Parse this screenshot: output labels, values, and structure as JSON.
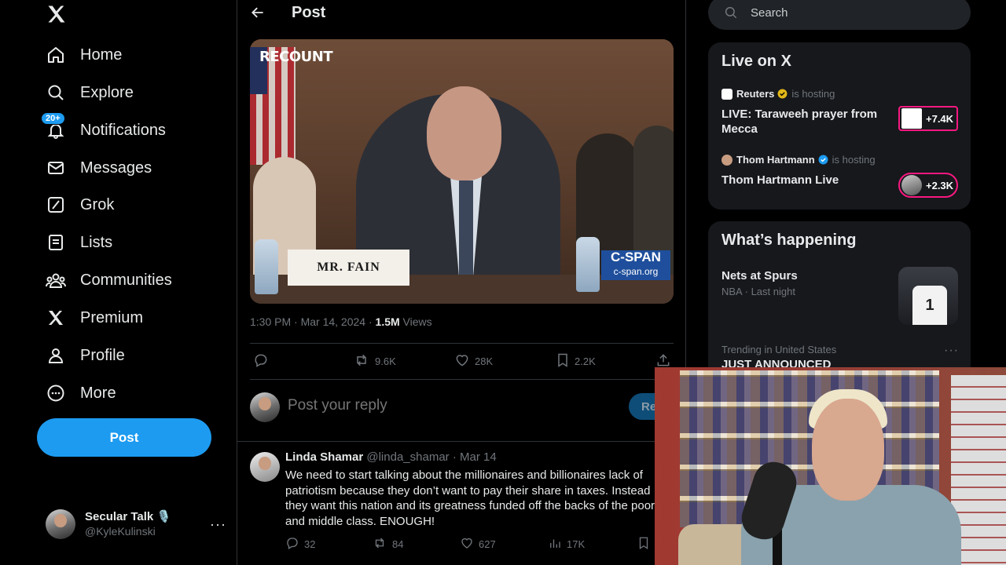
{
  "nav": {
    "items": [
      {
        "label": "Home",
        "icon": "home-icon"
      },
      {
        "label": "Explore",
        "icon": "search-icon"
      },
      {
        "label": "Notifications",
        "icon": "bell-icon",
        "badge": "20+"
      },
      {
        "label": "Messages",
        "icon": "mail-icon"
      },
      {
        "label": "Grok",
        "icon": "grok-icon"
      },
      {
        "label": "Lists",
        "icon": "lists-icon"
      },
      {
        "label": "Communities",
        "icon": "communities-icon"
      },
      {
        "label": "Premium",
        "icon": "x-logo-icon"
      },
      {
        "label": "Profile",
        "icon": "profile-icon"
      },
      {
        "label": "More",
        "icon": "more-circle-icon"
      }
    ],
    "post_button": "Post",
    "account": {
      "name": "Secular Talk 🎙️",
      "handle": "@KyleKulinski",
      "more": "···"
    }
  },
  "post": {
    "header_title": "Post",
    "media": {
      "watermark": "RECOUNT",
      "nameplate": "MR. FAIN",
      "network": "C-SPAN",
      "network_url": "c-span.org"
    },
    "time": "1:30 PM · Mar 14, 2024 · ",
    "views_count": "1.5M",
    "views_label": " Views",
    "stats": {
      "reposts": "9.6K",
      "likes": "28K",
      "bookmarks": "2.2K"
    },
    "reply_placeholder": "Post your reply",
    "reply_button": "Reply"
  },
  "comment": {
    "name": "Linda Shamar",
    "handle": "@linda_shamar",
    "date": " · Mar 14",
    "text": "We need to start talking about the millionaires and billionaires lack of patriotism because they don’t want to pay their share in taxes. Instead they want this nation and its greatness funded off the backs of the poor and middle class. ENOUGH!",
    "stats": {
      "replies": "32",
      "reposts": "84",
      "likes": "627",
      "views": "17K"
    }
  },
  "search": {
    "placeholder": "Search"
  },
  "live": {
    "title": "Live on X",
    "hosting_label": "is hosting",
    "items": [
      {
        "host": "Reuters",
        "title": "LIVE: Taraweeh prayer from Mecca",
        "count": "+7.4K"
      },
      {
        "host": "Thom Hartmann",
        "title": "Thom Hartmann Live",
        "count": "+2.3K"
      }
    ]
  },
  "happening": {
    "title": "What’s happening",
    "trends": [
      {
        "title": "Nets at Spurs",
        "sub": "NBA · Last night",
        "jersey": "1"
      },
      {
        "context": "Trending in United States",
        "title": "JUST ANNOUNCED"
      }
    ]
  },
  "colors": {
    "accent": "#1d9bf0",
    "live_ring": "#f91880",
    "bg": "#000000",
    "panel": "#16181c",
    "muted": "#71767b"
  }
}
